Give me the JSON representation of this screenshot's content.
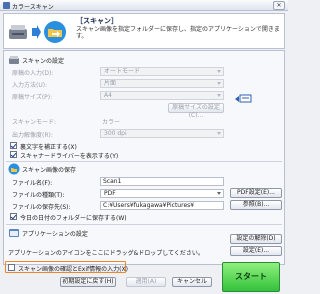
{
  "window": {
    "title": "カラースキャン",
    "close_label": "✕"
  },
  "header": {
    "title": "［スキャン］",
    "description": "スキャン画像を指定フォルダーに保存し、指定のアプリケーションで開きます。"
  },
  "scan_settings": {
    "section_title": "スキャンの設定",
    "paper_source_label": "原稿の入力(D):",
    "paper_source_value": "オートモード",
    "input_method_label": "入力方法(U):",
    "input_method_value": "片面",
    "paper_size_label": "原稿サイズ(P):",
    "paper_size_value": "A4",
    "custom_size_button": "原稿サイズの設定(C)...",
    "scan_mode_label": "スキャンモード:",
    "scan_mode_value": "カラー",
    "resolution_label": "出力解像度(R):",
    "resolution_value": "300 dpi",
    "auto_correct_label": "裏文字を補正する(X)",
    "show_driver_label": "スキャナードライバーを表示する(Y)"
  },
  "save_settings": {
    "section_title": "スキャン画像の保存",
    "filename_label": "ファイル名(F):",
    "filename_value": "Scan1",
    "filetype_label": "ファイルの種類(T):",
    "filetype_value": "PDF",
    "pdf_settings_button": "PDF設定(E)...",
    "folder_label": "ファイルの保存先(S):",
    "folder_value": "C:¥Users¥fukagawa¥Pictures¥",
    "browse_button": "参照(B)...",
    "subfolder_label": "今日の日付のフォルダーに保存する(W)"
  },
  "app_settings": {
    "section_title": "アプリケーションの設定",
    "drop_hint": "アプリケーションのアイコンをここにドラッグ&ドロップしてください。",
    "unlink_button": "設定の解除(D)",
    "settings_button": "設定(E)..."
  },
  "footer": {
    "exif_label": "スキャン画像の確認とExif情報の入力(X)",
    "reset_button": "初期設定に戻す(H)",
    "apply_button": "適用(A)",
    "cancel_button": "キャンセル",
    "start_button": "スタート"
  },
  "state": {
    "auto_correct_checked": true,
    "show_driver_checked": true,
    "subfolder_checked": true,
    "exif_checked": false
  },
  "colors": {
    "start_green": "#33c23a",
    "highlight_orange": "#f0862a",
    "title_navy": "#1b2a55"
  }
}
